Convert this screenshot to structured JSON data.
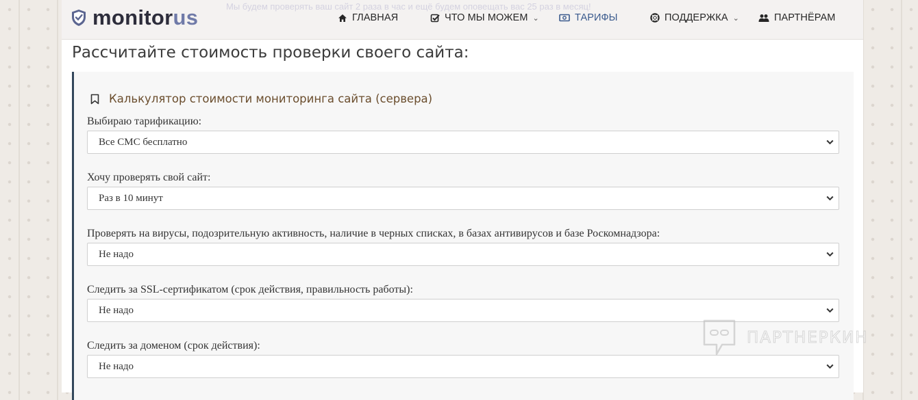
{
  "header": {
    "promo_text": "Мы будем проверять ваш сайт 2 раза в час и ещё будем оповещать вас 25 раз в месяц!",
    "logo": {
      "part1": "monitor",
      "part2": "us"
    },
    "nav": [
      {
        "label": "ГЛАВНАЯ",
        "icon": "home-icon"
      },
      {
        "label": "ЧТО МЫ МОЖЕМ",
        "icon": "checkbox-icon",
        "dropdown": true
      },
      {
        "label": "ТАРИФЫ",
        "icon": "money-icon",
        "active": true
      },
      {
        "label": "ПОДДЕРЖКА",
        "icon": "lifebuoy-icon",
        "dropdown": true
      },
      {
        "label": "ПАРТНЁРАМ",
        "icon": "users-icon"
      }
    ]
  },
  "main": {
    "title": "Рассчитайте стоимость проверки своего сайта:",
    "calculator": {
      "heading": "Калькулятор стоимости мониторинга сайта (сервера)",
      "fields": [
        {
          "label": "Выбираю тарификацию:",
          "value": "Все СМС бесплатно"
        },
        {
          "label": "Хочу проверять свой сайт:",
          "value": "Раз в 10 минут"
        },
        {
          "label": "Проверять на вирусы, подозрительную активность, наличие в черных списках, в базах антивирусов и базе Роскомнадзора:",
          "value": "Не надо"
        },
        {
          "label": "Следить за SSL-сертификатом (срок действия, правильность работы):",
          "value": "Не надо"
        },
        {
          "label": "Следить за доменом (срок действия):",
          "value": "Не надо"
        }
      ]
    }
  },
  "watermark": {
    "text": "ПАРТНЕРКИН"
  },
  "colors": {
    "accent": "#3a5a8d",
    "calc_border": "#33475b",
    "heading": "#6b4e2e"
  }
}
